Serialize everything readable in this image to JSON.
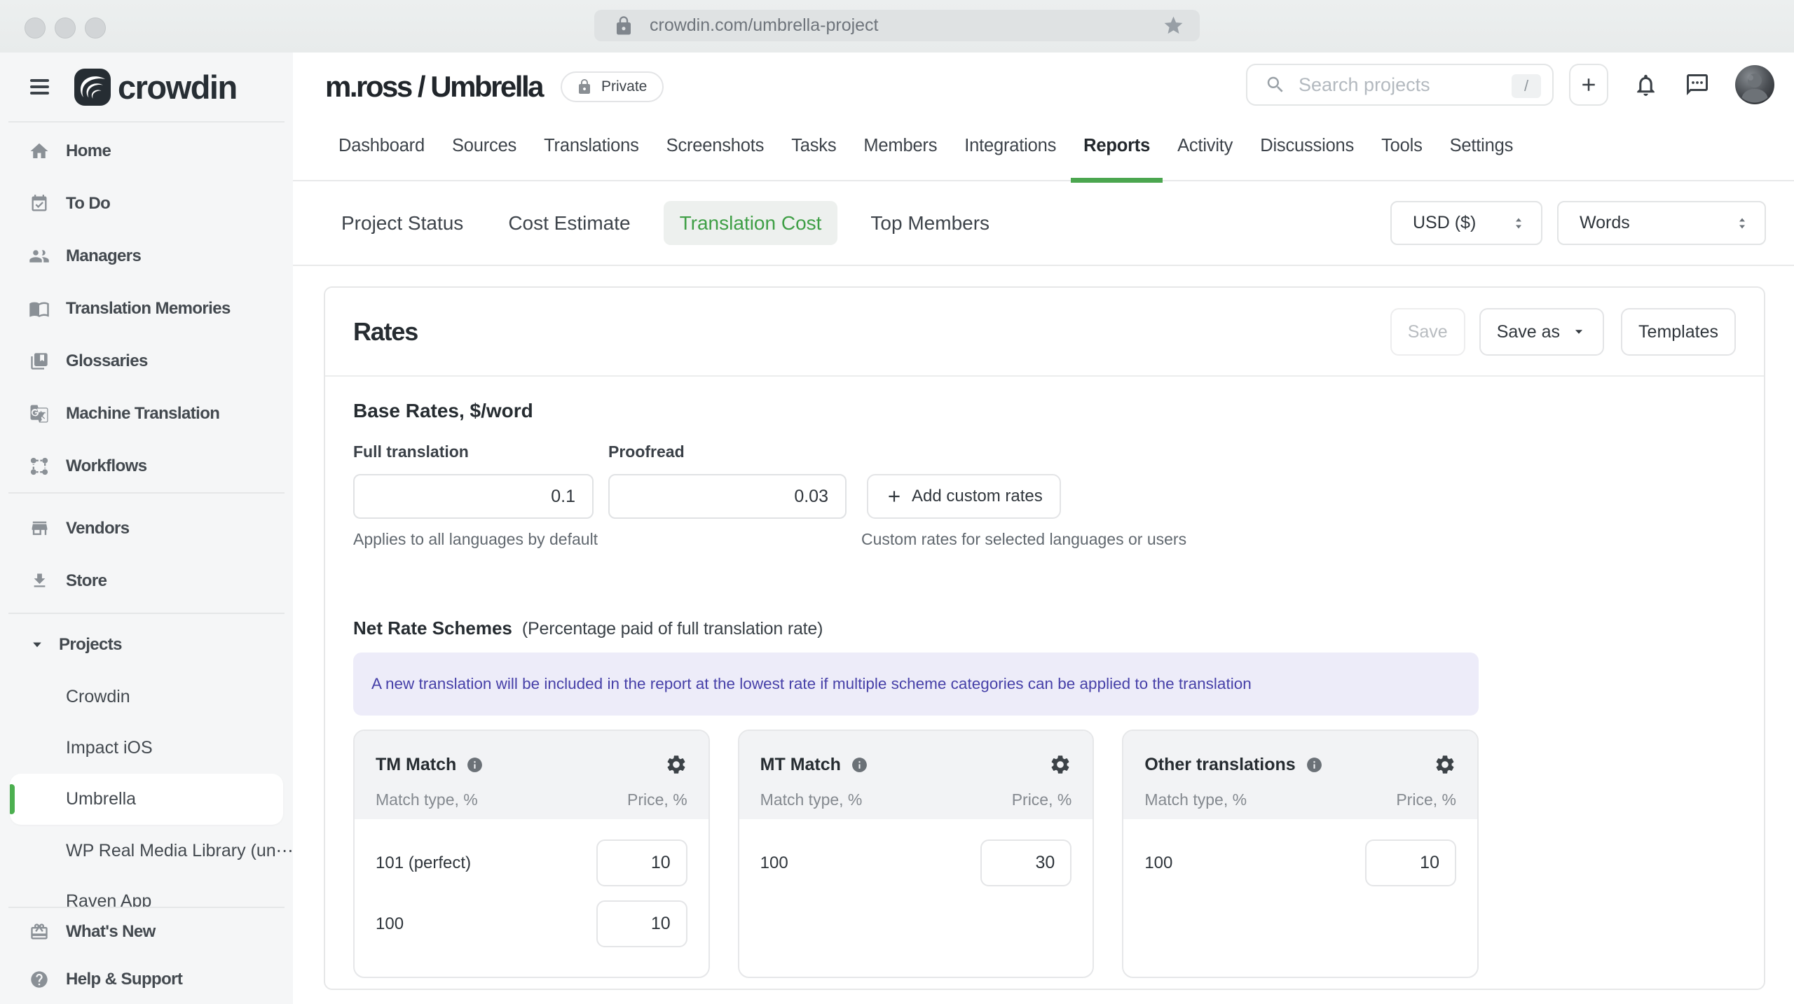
{
  "browser": {
    "url": "crowdin.com/umbrella-project"
  },
  "sidebar": {
    "brand": "crowdin",
    "items": [
      {
        "label": "Home",
        "icon": "home-icon"
      },
      {
        "label": "To Do",
        "icon": "todo-icon"
      },
      {
        "label": "Managers",
        "icon": "managers-icon"
      },
      {
        "label": "Translation Memories",
        "icon": "translation-memories-icon"
      },
      {
        "label": "Glossaries",
        "icon": "glossaries-icon"
      },
      {
        "label": "Machine Translation",
        "icon": "machine-translation-icon"
      },
      {
        "label": "Workflows",
        "icon": "workflows-icon"
      },
      {
        "label": "Vendors",
        "icon": "vendors-icon"
      },
      {
        "label": "Store",
        "icon": "store-icon"
      }
    ],
    "projects": {
      "label": "Projects",
      "children": [
        {
          "label": "Crowdin",
          "selected": false
        },
        {
          "label": "Impact iOS",
          "selected": false
        },
        {
          "label": "Umbrella",
          "selected": true
        },
        {
          "label": "WP Real Media Library (un⋯",
          "selected": false
        },
        {
          "label": "Raven App",
          "selected": false
        }
      ]
    },
    "footer": [
      {
        "label": "What's New",
        "icon": "whats-new-icon"
      },
      {
        "label": "Help & Support",
        "icon": "help-icon"
      }
    ]
  },
  "header": {
    "title": "m.ross / Umbrella",
    "privacy_badge": "Private",
    "search": {
      "placeholder": "Search projects",
      "shortcut": "/"
    }
  },
  "tabs": [
    {
      "label": "Dashboard"
    },
    {
      "label": "Sources"
    },
    {
      "label": "Translations"
    },
    {
      "label": "Screenshots"
    },
    {
      "label": "Tasks"
    },
    {
      "label": "Members"
    },
    {
      "label": "Integrations"
    },
    {
      "label": "Reports"
    },
    {
      "label": "Activity"
    },
    {
      "label": "Discussions"
    },
    {
      "label": "Tools"
    },
    {
      "label": "Settings"
    }
  ],
  "active_tab": "Reports",
  "subtabs": [
    {
      "label": "Project Status"
    },
    {
      "label": "Cost Estimate"
    },
    {
      "label": "Translation Cost"
    },
    {
      "label": "Top Members"
    }
  ],
  "active_subtab": "Translation Cost",
  "filters": {
    "currency": "USD ($)",
    "unit": "Words"
  },
  "rates": {
    "title": "Rates",
    "actions": {
      "save": "Save",
      "save_as": "Save as",
      "templates": "Templates"
    },
    "base": {
      "heading": "Base Rates, $/word",
      "full_label": "Full translation",
      "full_value": "0.1",
      "proofread_label": "Proofread",
      "proofread_value": "0.03",
      "add_button": "Add custom rates",
      "full_caption": "Applies to all languages by default",
      "add_caption": "Custom rates for selected languages or users"
    },
    "schemes": {
      "heading": "Net Rate Schemes",
      "subheading": "(Percentage paid of full translation rate)",
      "banner": "A new translation will be included in the report at the lowest rate if multiple scheme categories can be applied to the translation",
      "columns": {
        "left": "Match type, %",
        "right": "Price, %"
      },
      "cards": [
        {
          "title": "TM Match",
          "rows": [
            {
              "label": "101 (perfect)",
              "value": "10"
            },
            {
              "label": "100",
              "value": "10"
            }
          ]
        },
        {
          "title": "MT Match",
          "rows": [
            {
              "label": "100",
              "value": "30"
            }
          ]
        },
        {
          "title": "Other translations",
          "rows": [
            {
              "label": "100",
              "value": "10"
            }
          ]
        }
      ]
    }
  },
  "colors": {
    "accent_green": "#4ba64f",
    "banner_bg": "#edecf9",
    "banner_text": "#4640a8",
    "sidebar_bg": "#f5f6f7"
  }
}
